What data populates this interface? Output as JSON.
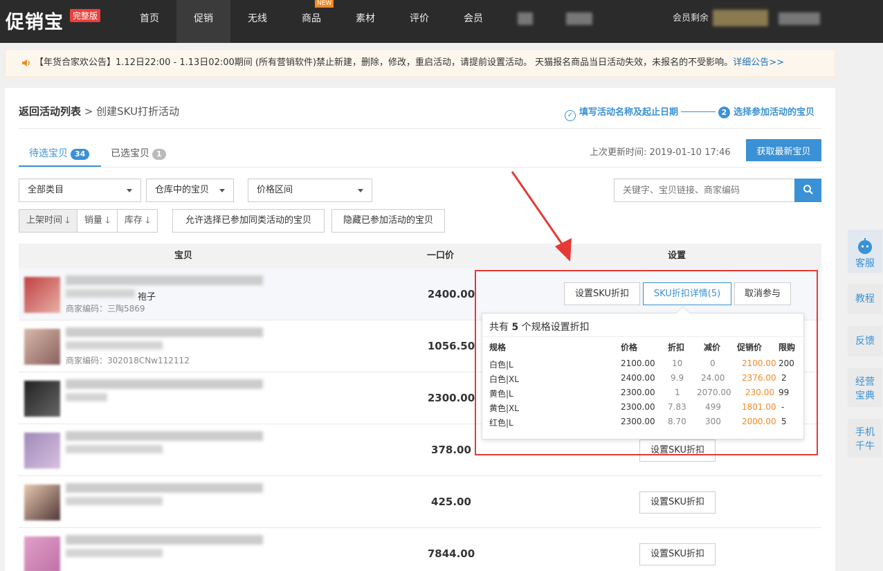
{
  "nav": {
    "logo": "促销宝",
    "edition": "完整版",
    "items": [
      "首页",
      "促销",
      "无线",
      "商品",
      "素材",
      "评价",
      "会员"
    ],
    "new_tag": "NEW",
    "member_text": "会员剩余"
  },
  "notice": {
    "text": "【年货合家欢公告】1.12日22:00 - 1.13日02:00期间 (所有营销软件)禁止新建，删除，修改，重启活动，请提前设置活动。 天猫报名商品当日活动失效，未报名的不受影响。",
    "link": "详细公告>>"
  },
  "crumb": {
    "back": "返回活动列表",
    "sep": " > ",
    "current": "创建SKU打折活动"
  },
  "steps": {
    "step1": "填写活动名称及起止日期",
    "step2_num": "2",
    "step2": "选择参加活动的宝贝"
  },
  "tabs": [
    {
      "label": "待选宝贝",
      "count": "34"
    },
    {
      "label": "已选宝贝",
      "count": "1"
    }
  ],
  "last_update": "上次更新时间: 2019-01-10 17:46",
  "refresh_button": "获取最新宝贝",
  "filters": {
    "category": "全部类目",
    "status": "仓库中的宝贝",
    "price_range": "价格区间",
    "search_placeholder": "关键字、宝贝链接、商家编码"
  },
  "sort": [
    "上架时间",
    "销量",
    "库存"
  ],
  "buttons": {
    "allow_same": "允许选择已参加同类活动的宝贝",
    "hide_joined": "隐藏已参加活动的宝贝"
  },
  "table_headers": [
    "宝贝",
    "一口价",
    "设置"
  ],
  "rows": [
    {
      "title": "袍子",
      "code": "商家编码：三陶5869",
      "price": "2400.00"
    },
    {
      "title": "",
      "code": "商家编码：302018CNw112112",
      "price": "1056.50"
    },
    {
      "title": "",
      "code": "",
      "price": "2300.00"
    },
    {
      "title": "",
      "code": "",
      "price": "378.00"
    },
    {
      "title": "",
      "code": "",
      "price": "425.00"
    },
    {
      "title": "",
      "code": "",
      "price": "7844.00"
    }
  ],
  "row_buttons": {
    "set_sku": "设置SKU折扣",
    "sku_detail": "SKU折扣详情(5)",
    "cancel": "取消参与"
  },
  "popover": {
    "title_pre": "共有",
    "title_num": "5",
    "title_post": "个规格设置折扣",
    "headers": [
      "规格",
      "价格",
      "折扣",
      "减价",
      "促销价",
      "限购"
    ],
    "rows": [
      [
        "白色|L",
        "2100.00",
        "10",
        "0",
        "2100.00",
        "200"
      ],
      [
        "白色|XL",
        "2400.00",
        "9.9",
        "24.00",
        "2376.00",
        "2"
      ],
      [
        "黄色|L",
        "2300.00",
        "1",
        "2070.00",
        "230.00",
        "99"
      ],
      [
        "黄色|XL",
        "2300.00",
        "7.83",
        "499",
        "1801.00",
        "-"
      ],
      [
        "红色|L",
        "2300.00",
        "8.70",
        "300",
        "2000.00",
        "5"
      ]
    ]
  },
  "sidebar": [
    "客服",
    "教程",
    "反馈",
    "经营宝典",
    "手机千牛"
  ],
  "colors": {
    "accent": "#3a91d6",
    "nav_bg": "#2b2b2b",
    "promo_price": "#f08a24",
    "highlight": "#e53935"
  }
}
